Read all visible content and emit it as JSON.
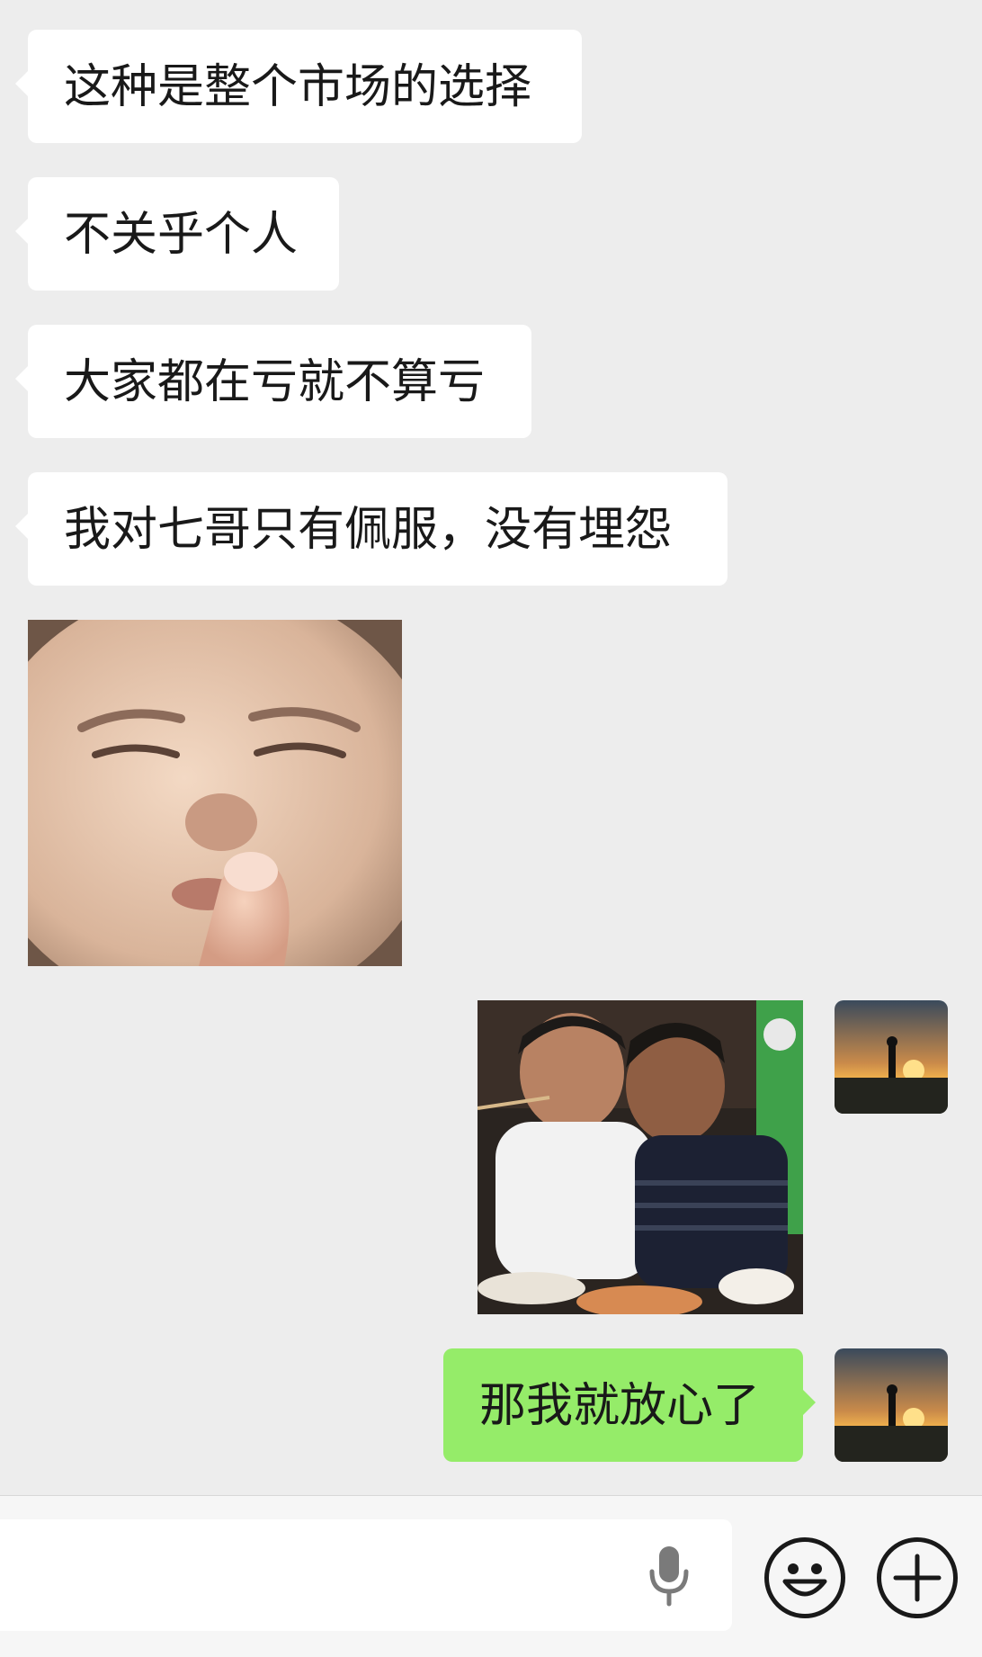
{
  "messages": [
    {
      "side": "left",
      "type": "text",
      "text": "这种是整个市场的选择"
    },
    {
      "side": "left",
      "type": "text",
      "text": "不关乎个人"
    },
    {
      "side": "left",
      "type": "text",
      "text": "大家都在亏就不算亏"
    },
    {
      "side": "left",
      "type": "text",
      "text": "我对七哥只有佩服，没有埋怨"
    },
    {
      "side": "left",
      "type": "image",
      "image_description": "child-squinting-sticker"
    },
    {
      "side": "right",
      "type": "image",
      "image_description": "two-men-at-dinner-photo"
    },
    {
      "side": "right",
      "type": "text",
      "text": "那我就放心了"
    }
  ],
  "input_bar": {
    "voice_icon": "microphone-icon",
    "emoji_icon": "smiley-icon",
    "more_icon": "plus-circle-icon"
  },
  "colors": {
    "background": "#ededed",
    "incoming_bubble": "#ffffff",
    "outgoing_bubble": "#95ec69",
    "text": "#191919"
  }
}
